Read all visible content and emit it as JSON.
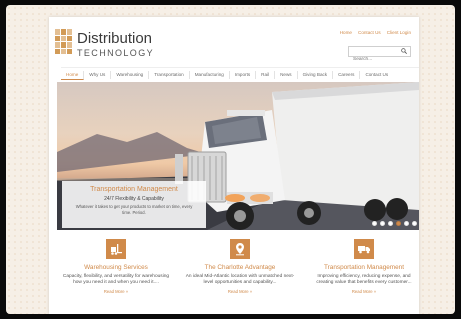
{
  "logo": {
    "name": "Distribution",
    "sub": "TECHNOLOGY"
  },
  "toplinks": [
    "Home",
    "Contact Us",
    "Client Login"
  ],
  "search": {
    "placeholder": "Search..."
  },
  "nav": [
    "Home",
    "Why Us",
    "Warehousing",
    "Transportation",
    "Manufacturing",
    "Imports",
    "Rail",
    "News",
    "Giving Back",
    "Careers",
    "Contact Us"
  ],
  "hero": {
    "title": "Transportation Management",
    "subtitle": "24/7 Flexibility & Capability",
    "body": "Whatever it takes to get your products to market on time, every time. Period.",
    "slides": 7,
    "active_slide": 3
  },
  "features": [
    {
      "icon": "forklift-icon",
      "title": "Warehousing Services",
      "text": "Capacity, flexibility, and versatility for warehousing how you need it and when you need it....",
      "more": "Read More »"
    },
    {
      "icon": "map-pin-icon",
      "title": "The Charlotte Advantage",
      "text": "An ideal Mid-Atlantic location with unmatched next-level opportunities and capability...",
      "more": "Read More »"
    },
    {
      "icon": "truck-icon",
      "title": "Transportation Management",
      "text": "Improving efficiency, reducing expense, and creating value that benefits every customer...",
      "more": "Read More »"
    }
  ],
  "colors": {
    "accent": "#d08a4a",
    "page_bg": "#f6efe6"
  }
}
